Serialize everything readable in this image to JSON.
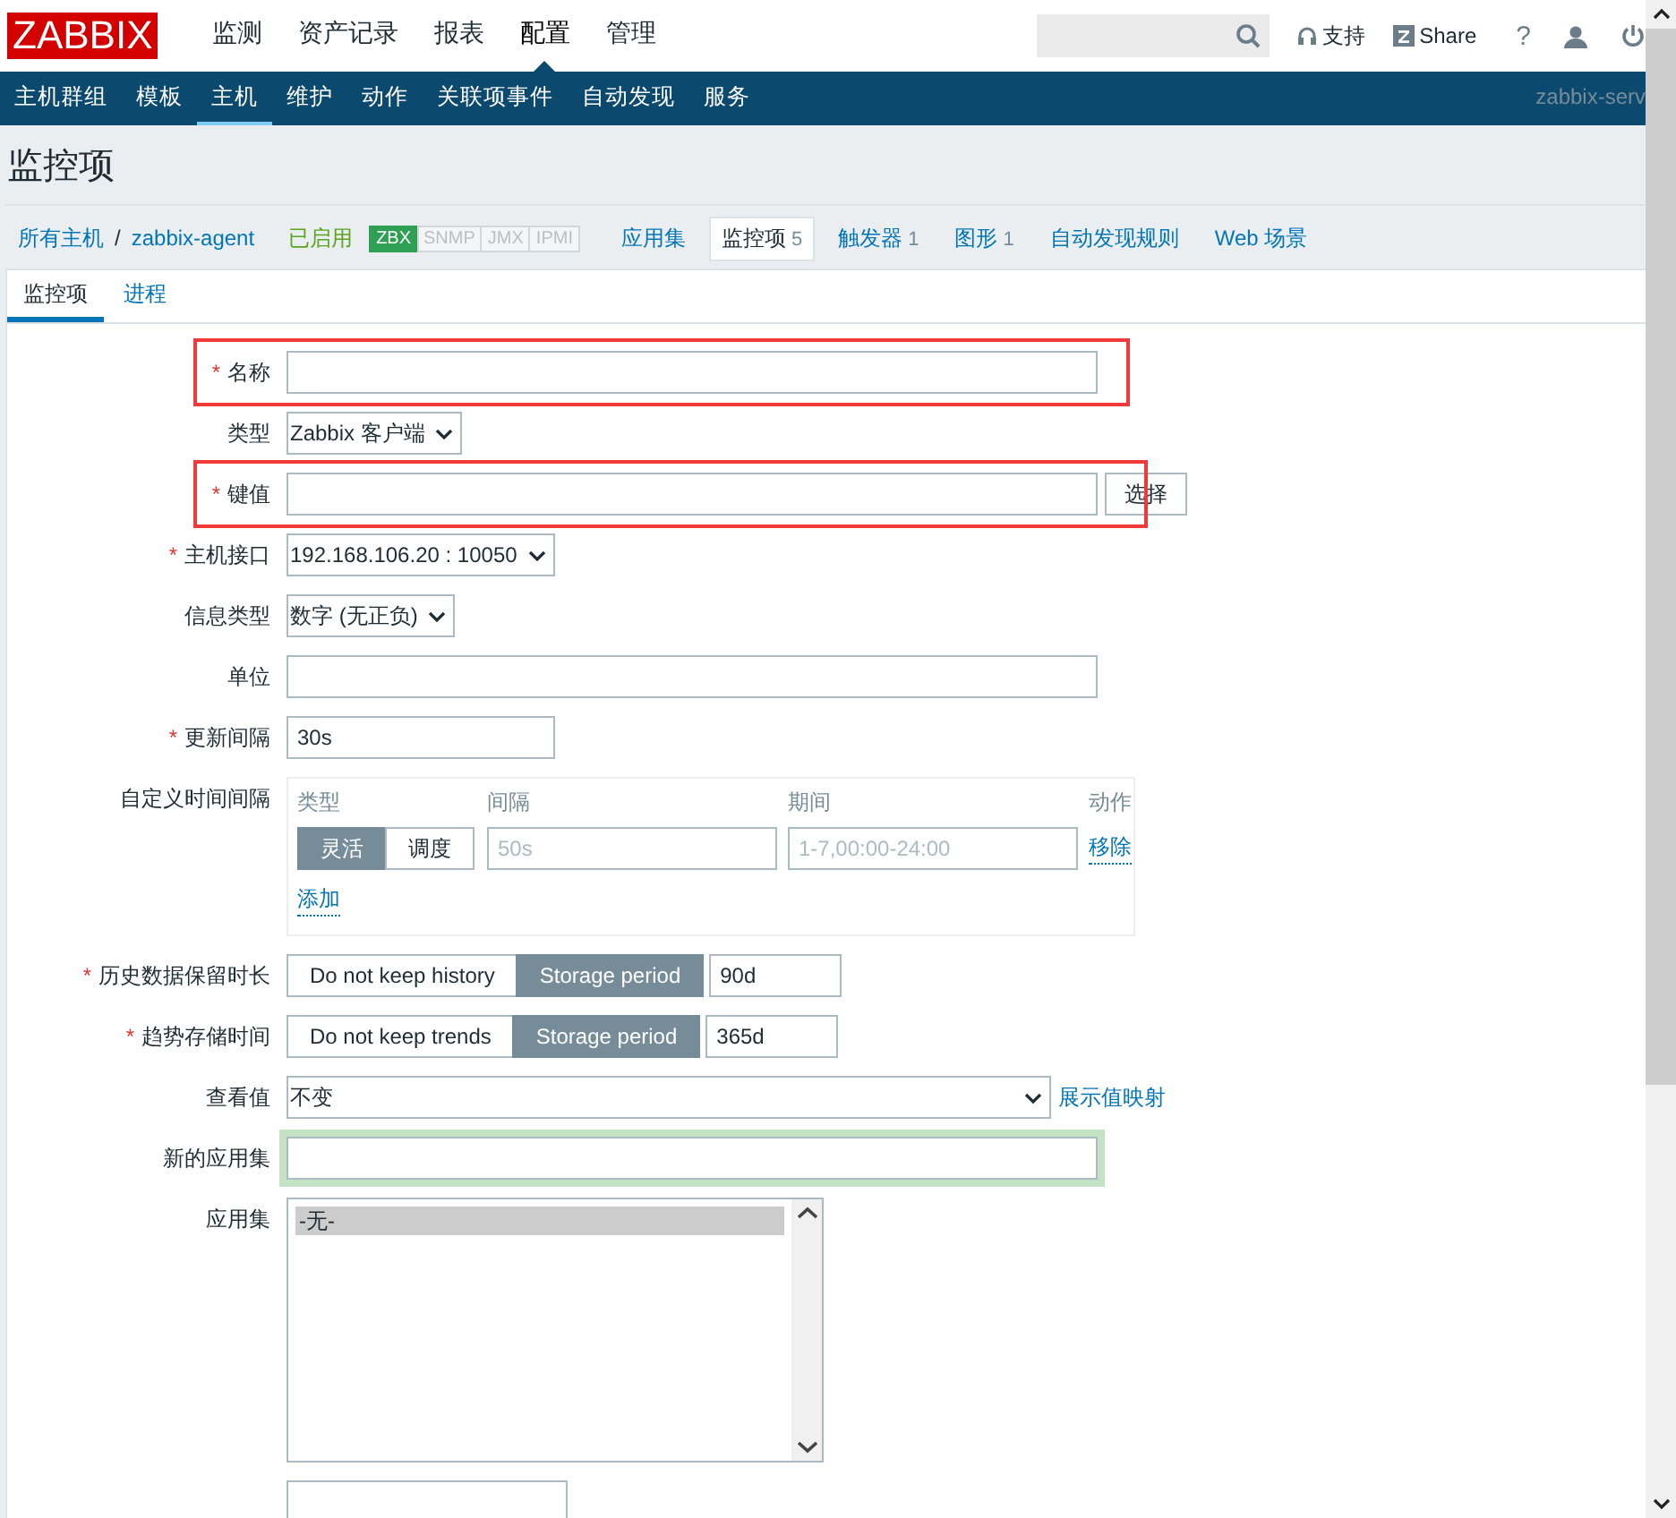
{
  "header": {
    "logo": "ZABBIX",
    "menu": [
      {
        "label": "监测",
        "selected": false
      },
      {
        "label": "资产记录",
        "selected": false
      },
      {
        "label": "报表",
        "selected": false
      },
      {
        "label": "配置",
        "selected": true
      },
      {
        "label": "管理",
        "selected": false
      }
    ],
    "links": [
      {
        "kind": "support",
        "label": "支持"
      },
      {
        "kind": "share",
        "label": "Share"
      },
      {
        "kind": "help",
        "label": "?"
      }
    ]
  },
  "subnav": {
    "items": [
      {
        "label": "主机群组",
        "selected": false
      },
      {
        "label": "模板",
        "selected": false
      },
      {
        "label": "主机",
        "selected": true
      },
      {
        "label": "维护",
        "selected": false
      },
      {
        "label": "动作",
        "selected": false
      },
      {
        "label": "关联项事件",
        "selected": false
      },
      {
        "label": "自动发现",
        "selected": false
      },
      {
        "label": "服务",
        "selected": false
      }
    ],
    "server": "zabbix-serv"
  },
  "page_title": "监控项",
  "breadcrumbs": [
    "所有主机",
    "zabbix-agent"
  ],
  "breadcrumb_separator": "/",
  "host_status": "已启用",
  "availability": [
    {
      "label": "ZBX",
      "on": true
    },
    {
      "label": "SNMP",
      "on": false
    },
    {
      "label": "JMX",
      "on": false
    },
    {
      "label": "IPMI",
      "on": false
    }
  ],
  "host_tabs": [
    {
      "label": "应用集",
      "selected": false
    },
    {
      "label": "监控项",
      "count": "5",
      "selected": true
    },
    {
      "label": "触发器",
      "count": "1",
      "selected": false
    },
    {
      "label": "图形",
      "count": "1",
      "selected": false
    },
    {
      "label": "自动发现规则",
      "selected": false
    },
    {
      "label": "Web 场景",
      "selected": false
    }
  ],
  "form_tabs": [
    {
      "label": "监控项",
      "selected": true
    },
    {
      "label": "进程",
      "selected": false
    }
  ],
  "fields": [
    {
      "kind": "text",
      "label": "名称",
      "required_mark": "*",
      "highlighted": true
    },
    {
      "kind": "select",
      "label": "类型",
      "value": "Zabbix 客户端"
    },
    {
      "kind": "text",
      "label": "键值",
      "required_mark": "*",
      "highlighted": true,
      "button": "选择"
    },
    {
      "kind": "select",
      "label": "主机接口",
      "required_mark": "*",
      "value": "192.168.106.20 : 10050"
    },
    {
      "kind": "select",
      "label": "信息类型",
      "value": "数字 (无正负)"
    },
    {
      "kind": "text",
      "label": "单位"
    },
    {
      "kind": "short",
      "label": "更新间隔",
      "required_mark": "*",
      "value": "30s"
    },
    {
      "kind": "intervals",
      "label": "自定义时间间隔",
      "columns": [
        "类型",
        "间隔",
        "期间",
        "动作"
      ],
      "rows": [
        {
          "modes": [
            {
              "label": "灵活",
              "selected": true
            },
            {
              "label": "调度",
              "selected": false
            }
          ],
          "interval_placeholder": "50s",
          "period_placeholder": "1-7,00:00-24:00",
          "action": "移除"
        }
      ],
      "add": "添加"
    },
    {
      "kind": "storage",
      "label": "历史数据保留时长",
      "required_mark": "*",
      "modes": [
        {
          "label": "Do not keep history",
          "selected": false
        },
        {
          "label": "Storage period",
          "selected": true
        }
      ],
      "value": "90d"
    },
    {
      "kind": "storage",
      "label": "趋势存储时间",
      "required_mark": "*",
      "modes": [
        {
          "label": "Do not keep trends",
          "selected": false
        },
        {
          "label": "Storage period",
          "selected": true
        }
      ],
      "value": "365d"
    },
    {
      "kind": "select",
      "label": "查看值",
      "value": "不变",
      "wide": true,
      "link": "展示值映射"
    },
    {
      "kind": "text",
      "label": "新的应用集",
      "focused": true
    },
    {
      "kind": "listbox",
      "label": "应用集",
      "options": [
        {
          "label": "-无-",
          "selected": true
        }
      ]
    },
    {
      "kind": "partial"
    }
  ]
}
